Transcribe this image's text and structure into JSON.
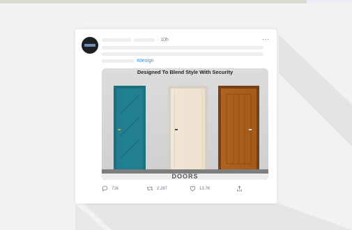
{
  "post": {
    "time": "· 10h",
    "more": "···",
    "hashtag": "#design"
  },
  "media": {
    "title": "Designed To Blend Style With Security",
    "brand": "DOORS"
  },
  "actions": {
    "replies": "716",
    "retweets": "2,287",
    "likes": "13.7K"
  },
  "icons": [
    "comment-icon",
    "retweet-icon",
    "heart-icon",
    "share-icon",
    "more-icon"
  ],
  "colors": {
    "link": "#3b8fd6",
    "card": "#ffffff",
    "background": "#f2f2f2"
  }
}
